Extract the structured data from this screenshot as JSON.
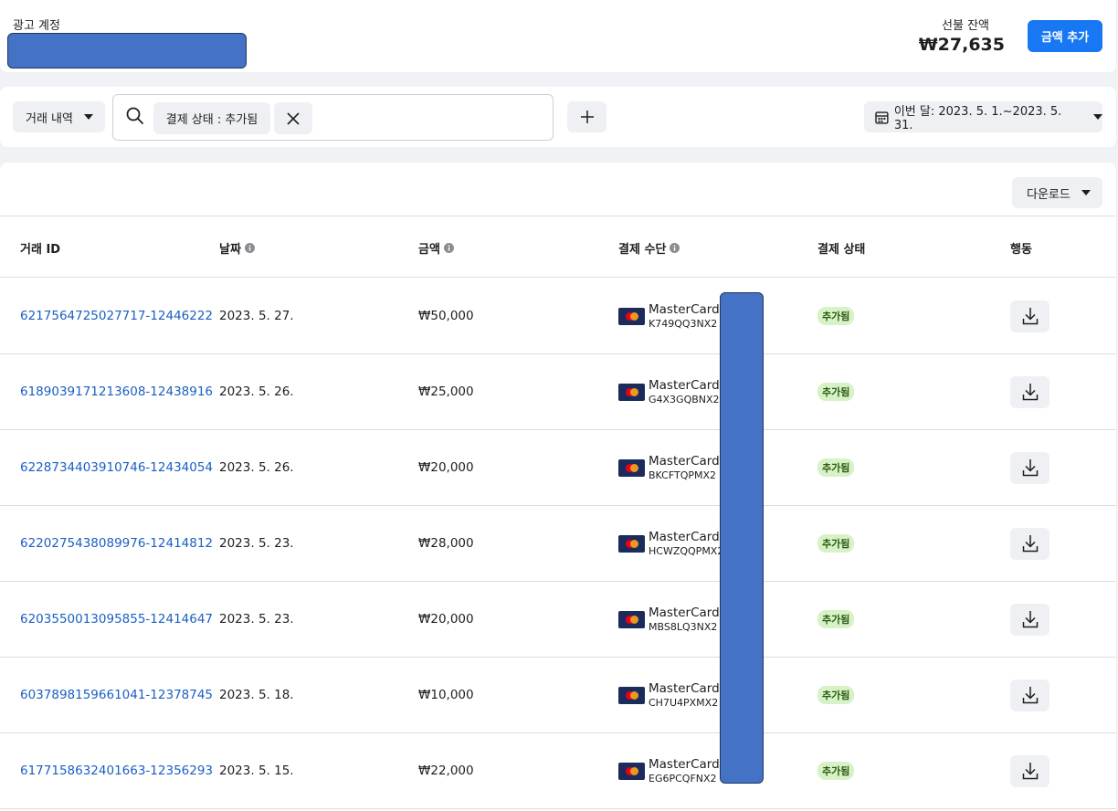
{
  "header": {
    "account_label": "광고 계정",
    "balance_label": "선불 잔액",
    "balance_value": "₩27,635",
    "add_funds_label": "금액 추가"
  },
  "filters": {
    "history_dropdown": "거래 내역",
    "chip_label": "결제 상태 : 추가됨",
    "date_range": "이번 달: 2023. 5. 1.~2023. 5. 31."
  },
  "table": {
    "download_label": "다운로드",
    "columns": [
      "거래 ID",
      "날짜",
      "금액",
      "결제 수단",
      "결제 상태",
      "행동"
    ],
    "rows": [
      {
        "id": "6217564725027717-12446222",
        "date": "2023. 5. 27.",
        "amount": "₩50,000",
        "method": "MasterCard ·",
        "code": "K749QQ3NX2",
        "status": "추가됨"
      },
      {
        "id": "6189039171213608-12438916",
        "date": "2023. 5. 26.",
        "amount": "₩25,000",
        "method": "MasterCard ·",
        "code": "G4X3GQBNX2",
        "status": "추가됨"
      },
      {
        "id": "6228734403910746-12434054",
        "date": "2023. 5. 26.",
        "amount": "₩20,000",
        "method": "MasterCard ·",
        "code": "BKCFTQPMX2",
        "status": "추가됨"
      },
      {
        "id": "6220275438089976-12414812",
        "date": "2023. 5. 23.",
        "amount": "₩28,000",
        "method": "MasterCard ·",
        "code": "HCWZQQPMX2",
        "status": "추가됨"
      },
      {
        "id": "6203550013095855-12414647",
        "date": "2023. 5. 23.",
        "amount": "₩20,000",
        "method": "MasterCard ·",
        "code": "MBS8LQ3NX2",
        "status": "추가됨"
      },
      {
        "id": "6037898159661041-12378745",
        "date": "2023. 5. 18.",
        "amount": "₩10,000",
        "method": "MasterCard ·",
        "code": "CH7U4PXMX2",
        "status": "추가됨"
      },
      {
        "id": "6177158632401663-12356293",
        "date": "2023. 5. 15.",
        "amount": "₩22,000",
        "method": "MasterCard ·",
        "code": "EG6PCQFNX2",
        "status": "추가됨"
      }
    ]
  },
  "colors": {
    "accent": "#1877f2",
    "link": "#1a5fc2",
    "status_bg": "#d7f2c6",
    "redaction": "#4472c4"
  }
}
